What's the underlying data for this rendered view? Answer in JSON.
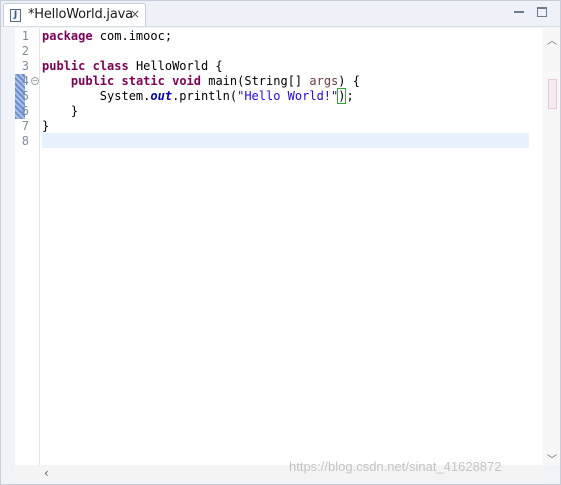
{
  "tab": {
    "title": "*HelloWorld.java",
    "icon": "J",
    "close_glyph": "×"
  },
  "editor": {
    "line_numbers": [
      "1",
      "2",
      "3",
      "4",
      "5",
      "6",
      "7",
      "8"
    ],
    "lines": {
      "l1_kw": "package",
      "l1_rest": " com.imooc;",
      "l3_kw1": "public",
      "l3_kw2": "class",
      "l3_rest": " HelloWorld {",
      "l4_indent": "    ",
      "l4_kw1": "public",
      "l4_kw2": "static",
      "l4_kw3": "void",
      "l4_mid": " main(String[] ",
      "l4_param": "args",
      "l4_end": ") {",
      "l5_indent": "        ",
      "l5_sys": "System.",
      "l5_out": "out",
      "l5_call": ".println(",
      "l5_str": "\"Hello World!\"",
      "l5_close": ")",
      "l5_semi": ";",
      "l6": "    }",
      "l7": "}"
    }
  },
  "watermark": "https://blog.csdn.net/sinat_41628872",
  "colors": {
    "keyword": "#7f0055",
    "string": "#2a00ff",
    "current_line": "#e8f2fe"
  }
}
